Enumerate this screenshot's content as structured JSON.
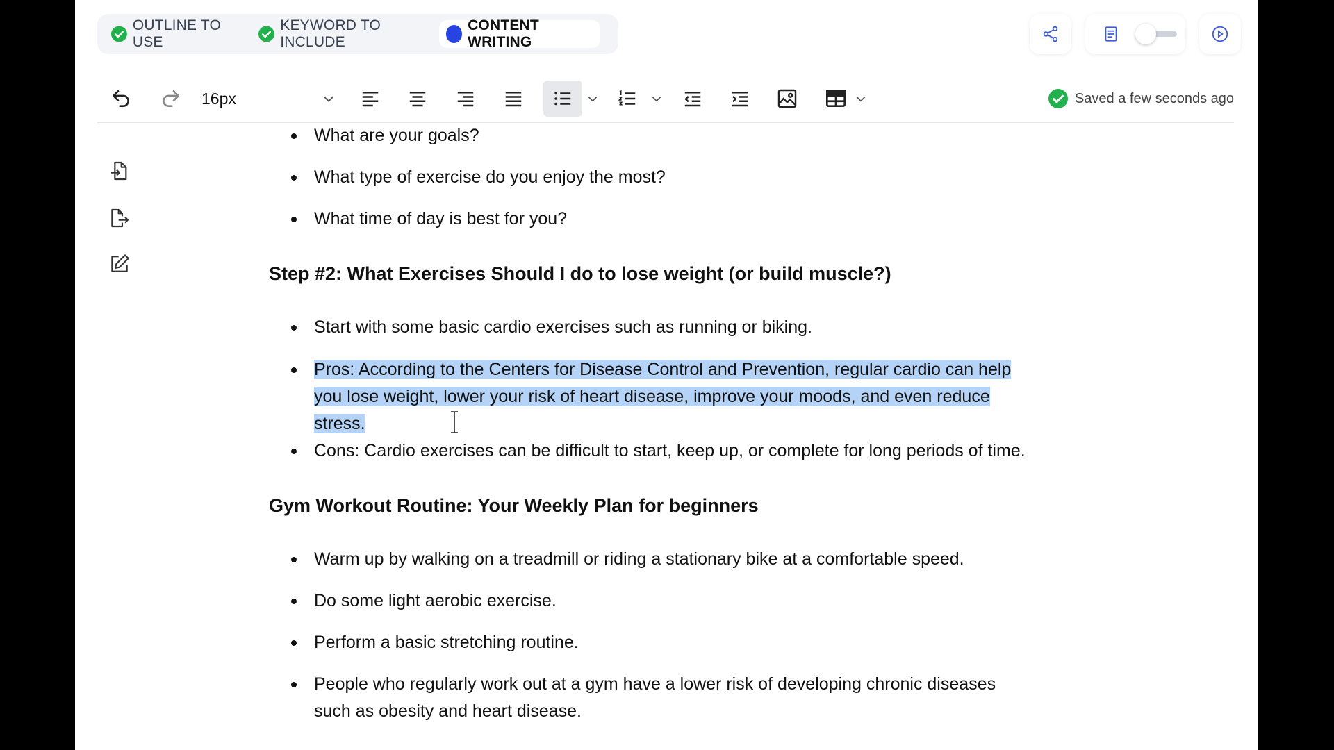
{
  "steps": [
    {
      "label": "OUTLINE TO USE",
      "state": "done"
    },
    {
      "label": "KEYWORD TO INCLUDE",
      "state": "done"
    },
    {
      "label": "CONTENT WRITING",
      "state": "active"
    }
  ],
  "colors": {
    "done": "#22b14c",
    "active": "#2844e0",
    "selection": "#b4d3f7"
  },
  "toolbar": {
    "font_size": "16px",
    "saved_status": "Saved a few seconds ago",
    "icons": [
      "undo-icon",
      "redo-icon",
      "chevron-down-icon",
      "align-left-icon",
      "align-center-icon",
      "align-right-icon",
      "align-justify-icon",
      "bullet-list-icon",
      "numbered-list-icon",
      "outdent-icon",
      "indent-icon",
      "image-icon",
      "table-icon"
    ]
  },
  "top_right": {
    "icons": [
      "share-icon",
      "document-icon",
      "toggle",
      "play-icon"
    ]
  },
  "rail": {
    "icons": [
      "import-icon",
      "export-icon",
      "edit-icon"
    ]
  },
  "content": {
    "list1": [
      "What are your goals?",
      "What type of exercise do you enjoy the most?",
      "What time of day is best for you?"
    ],
    "heading1": "Step #2: What Exercises Should I do to lose weight (or build muscle?)",
    "list2_item1": "Start with some basic cardio exercises such as running or biking.",
    "list2_pros_line1": "Pros: According to the Centers for Disease Control and Prevention, regular cardio can help",
    "list2_pros_line2": "you lose weight, lower your risk of heart disease, improve your moods, and even reduce",
    "list2_pros_line3": "stress.",
    "list2_cons": "Cons: Cardio exercises can be difficult to start, keep up, or complete for long periods of time.",
    "heading2": "Gym Workout Routine: Your Weekly Plan for beginners",
    "list3": [
      "Warm up by walking on a treadmill or riding a stationary bike at a comfortable speed.",
      "Do some light aerobic exercise.",
      "Perform a basic stretching routine."
    ],
    "list3_last_line1": "People who regularly work out at a gym have a lower risk of developing chronic diseases",
    "list3_last_line2": "such as obesity and heart disease."
  }
}
